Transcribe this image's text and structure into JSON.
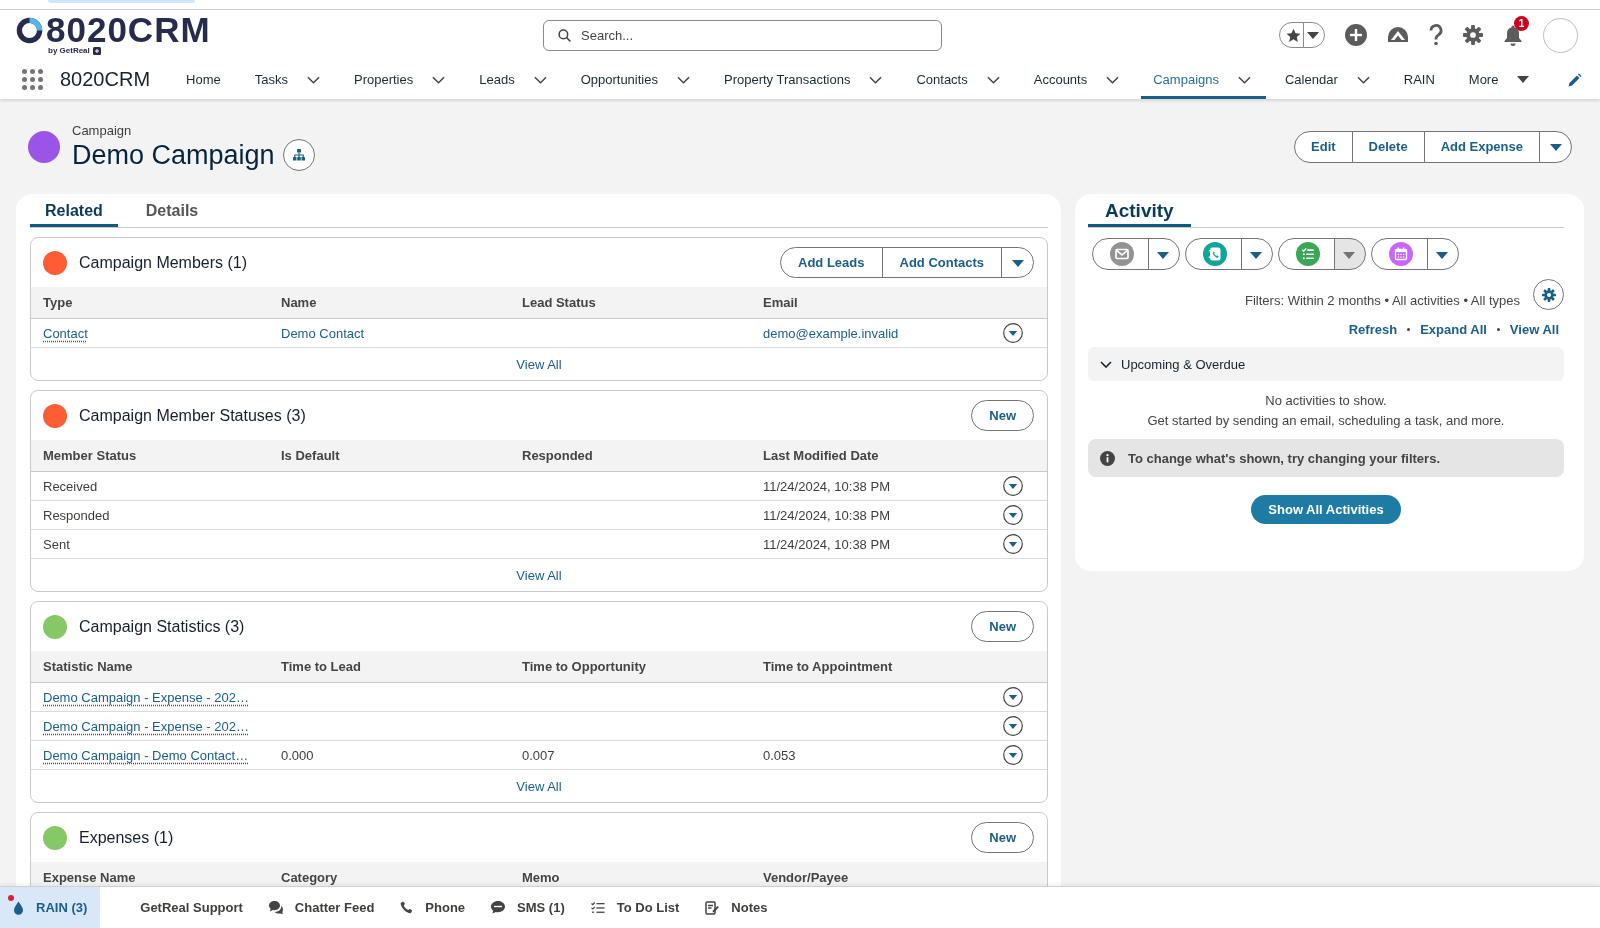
{
  "top_bar": {
    "logo": {
      "wordmark": "8020CRM",
      "byline": "by GetReal"
    },
    "search": {
      "placeholder": "Search..."
    },
    "notifications": {
      "count": "1"
    }
  },
  "nav": {
    "app_name": "8020CRM",
    "items": [
      {
        "label": "Home",
        "kind": "link",
        "selected": false
      },
      {
        "label": "Tasks",
        "kind": "dropdown",
        "selected": false
      },
      {
        "label": "Properties",
        "kind": "dropdown",
        "selected": false
      },
      {
        "label": "Leads",
        "kind": "dropdown",
        "selected": false
      },
      {
        "label": "Opportunities",
        "kind": "dropdown",
        "selected": false
      },
      {
        "label": "Property Transactions",
        "kind": "dropdown",
        "selected": false
      },
      {
        "label": "Contacts",
        "kind": "dropdown",
        "selected": false
      },
      {
        "label": "Accounts",
        "kind": "dropdown",
        "selected": false
      },
      {
        "label": "Campaigns",
        "kind": "dropdown",
        "selected": true
      },
      {
        "label": "Calendar",
        "kind": "dropdown",
        "selected": false
      },
      {
        "label": "RAIN",
        "kind": "link",
        "selected": false
      },
      {
        "label": "More",
        "kind": "menu",
        "selected": false
      }
    ]
  },
  "record": {
    "object_type": "Campaign",
    "title": "Demo Campaign",
    "actions": [
      "Edit",
      "Delete",
      "Add Expense"
    ],
    "menu": true
  },
  "related": {
    "tabs": [
      {
        "label": "Related",
        "selected": true
      },
      {
        "label": "Details",
        "selected": false
      }
    ],
    "sections": [
      {
        "title": "Campaign Members (1)",
        "color": "#fe5c35",
        "buttons": [
          "Add Leads",
          "Add Contacts"
        ],
        "menu": true,
        "columns": [
          "Type",
          "Name",
          "Lead Status",
          "Email"
        ],
        "rows": [
          {
            "cells": [
              {
                "text": "Contact",
                "kind": "record_link"
              },
              {
                "text": "Demo Contact",
                "kind": "link"
              },
              null,
              {
                "text": "demo@example.invalid",
                "kind": "link"
              }
            ]
          }
        ],
        "footer_link": "View All"
      },
      {
        "title": "Campaign Member Statuses (3)",
        "color": "#fe5c35",
        "buttons": [
          "New"
        ],
        "menu": false,
        "columns": [
          "Member Status",
          "Is Default",
          "Responded",
          "Last Modified Date"
        ],
        "rows": [
          {
            "cells": [
              {
                "text": "Received",
                "kind": "text"
              },
              null,
              null,
              {
                "text": "11/24/2024, 10:38 PM",
                "kind": "text"
              }
            ]
          },
          {
            "cells": [
              {
                "text": "Responded",
                "kind": "text"
              },
              null,
              null,
              {
                "text": "11/24/2024, 10:38 PM",
                "kind": "text"
              }
            ]
          },
          {
            "cells": [
              {
                "text": "Sent",
                "kind": "text"
              },
              null,
              null,
              {
                "text": "11/24/2024, 10:38 PM",
                "kind": "text"
              }
            ]
          }
        ],
        "footer_link": "View All"
      },
      {
        "title": "Campaign Statistics (3)",
        "color": "#86c865",
        "buttons": [
          "New"
        ],
        "menu": false,
        "columns": [
          "Statistic Name",
          "Time to Lead",
          "Time to Opportunity",
          "Time to Appointment"
        ],
        "rows": [
          {
            "cells": [
              {
                "text": "Demo Campaign - Expense - 202…",
                "kind": "record_link"
              },
              null,
              null,
              null
            ]
          },
          {
            "cells": [
              {
                "text": "Demo Campaign - Expense - 202…",
                "kind": "record_link"
              },
              null,
              null,
              null
            ]
          },
          {
            "cells": [
              {
                "text": "Demo Campaign - Demo Contact…",
                "kind": "record_link"
              },
              {
                "text": "0.000",
                "kind": "text"
              },
              {
                "text": "0.007",
                "kind": "text"
              },
              {
                "text": "0.053",
                "kind": "text"
              }
            ]
          }
        ],
        "footer_link": "View All"
      },
      {
        "title": "Expenses (1)",
        "color": "#86c865",
        "buttons": [
          "New"
        ],
        "menu": false,
        "columns": [
          "Expense Name",
          "Category",
          "Memo",
          "Vendor/Payee"
        ]
      }
    ]
  },
  "activity": {
    "tabs": [
      {
        "label": "Activity",
        "selected": true
      }
    ],
    "composers": [
      {
        "kind": "email",
        "color": "#939393",
        "menu_disabled": false
      },
      {
        "kind": "call",
        "color": "#0ea59a",
        "menu_disabled": false
      },
      {
        "kind": "task",
        "color": "#3ba755",
        "menu_disabled": true
      },
      {
        "kind": "event",
        "color": "#cb65ff",
        "menu_disabled": false
      }
    ],
    "filters": "Filters: Within 2 months • All activities • All types",
    "links": [
      "Refresh",
      "Expand All",
      "View All"
    ],
    "group": {
      "label": "Upcoming & Overdue",
      "expanded": true
    },
    "empty_title": "No activities to show.",
    "empty_hint": "Get started by sending an email, scheduling a task, and more.",
    "notice": "To change what's shown, try changing your filters.",
    "show_all": "Show All Activities"
  },
  "utility_bar": {
    "items": [
      {
        "label": "RAIN (3)",
        "kind": "drop",
        "selected": true,
        "unread": true
      },
      {
        "label": "GetReal Support",
        "kind": "text",
        "selected": false,
        "unread": false
      },
      {
        "label": "Chatter Feed",
        "kind": "chat",
        "selected": false,
        "unread": false
      },
      {
        "label": "Phone",
        "kind": "phone",
        "selected": false,
        "unread": false
      },
      {
        "label": "SMS (1)",
        "kind": "sms",
        "selected": false,
        "unread": false
      },
      {
        "label": "To Do List",
        "kind": "checklist",
        "selected": false,
        "unread": false
      },
      {
        "label": "Notes",
        "kind": "notes",
        "selected": false,
        "unread": false
      }
    ]
  }
}
